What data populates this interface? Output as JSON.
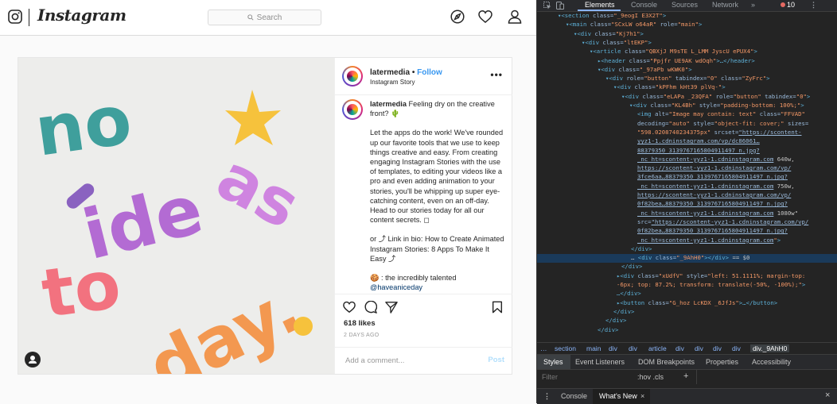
{
  "instagram": {
    "wordmark": "Instagram",
    "search_placeholder": "Search",
    "post": {
      "username": "latermedia",
      "follow_label": "Follow",
      "separator": "•",
      "subtitle": "Instagram Story",
      "more_label": "•••",
      "caption_user": "latermedia",
      "caption_p1": "Feeling dry on the creative front? 🌵",
      "caption_p2": "Let the apps do the work! We've rounded up our favorite tools that we use to keep things creative and easy. From creating engaging Instagram Stories with the use of templates, to editing your videos like a pro and even adding animation to your stories, you'll be whipping up super eye-catching content, even on an off-day. Head to our stories today for all our content secrets. ◻",
      "caption_p3": "or ⤴ Link in bio: How to Create Animated Instagram Stories: 8 Apps To Make It Easy ⤴",
      "caption_p4_prefix": "🍪 : the incredibly talented",
      "caption_mention": "@haveaniceday",
      "likes": "618 likes",
      "date": "2 DAYS AGO",
      "comment_placeholder": "Add a comment...",
      "post_button": "Post",
      "image_text": [
        "no",
        "ide",
        "as",
        "to",
        "day."
      ]
    },
    "colors": {
      "link": "#3897f0",
      "post_disabled": "#b2dffc"
    }
  },
  "devtools": {
    "tabs": [
      "Elements",
      "Console",
      "Sources",
      "Network",
      "»"
    ],
    "active_tab": "Elements",
    "error_count": "10",
    "dom_lines": [
      {
        "t": [
          [
            "tg",
            "▾<section "
          ],
          [
            "an",
            "class="
          ],
          [
            "av",
            "\"_9eogI E3X2T\""
          ],
          [
            "tg",
            ">"
          ]
        ]
      },
      {
        "t": [
          [
            "tg",
            "▾<main "
          ],
          [
            "an",
            "class="
          ],
          [
            "av",
            "\"SCxLW  o64aR\" "
          ],
          [
            "an",
            "role="
          ],
          [
            "av",
            "\"main\""
          ],
          [
            "tg",
            ">"
          ]
        ]
      },
      {
        "t": [
          [
            "tg",
            "▾<div "
          ],
          [
            "an",
            "class="
          ],
          [
            "av",
            "\"Kj7h1\""
          ],
          [
            "tg",
            ">"
          ]
        ]
      },
      {
        "t": [
          [
            "tg",
            "▾<div "
          ],
          [
            "an",
            "class="
          ],
          [
            "av",
            "\"ltEKP\""
          ],
          [
            "tg",
            ">"
          ]
        ]
      },
      {
        "t": [
          [
            "tg",
            "▾<article "
          ],
          [
            "an",
            "class="
          ],
          [
            "av",
            "\"QBXjJ M9sTE  L_LMM  JyscU  ePUX4\""
          ],
          [
            "tg",
            ">"
          ]
        ]
      },
      {
        "t": [
          [
            "tg",
            "▸<header "
          ],
          [
            "an",
            "class="
          ],
          [
            "av",
            "\"Ppjfr UE9AK  wdOqh\""
          ],
          [
            "tg",
            ">…</header>"
          ]
        ]
      },
      {
        "t": [
          [
            "tg",
            "▾<div "
          ],
          [
            "an",
            "class="
          ],
          [
            "av",
            "\"_97aPb wKWK0\""
          ],
          [
            "tg",
            ">"
          ]
        ]
      },
      {
        "t": [
          [
            "tg",
            "▾<div "
          ],
          [
            "an",
            "role="
          ],
          [
            "av",
            "\"button\" "
          ],
          [
            "an",
            "tabindex="
          ],
          [
            "av",
            "\"0\" "
          ],
          [
            "an",
            "class="
          ],
          [
            "av",
            "\"ZyFrc\""
          ],
          [
            "tg",
            ">"
          ]
        ]
      },
      {
        "t": [
          [
            "tg",
            "▾<div "
          ],
          [
            "an",
            "class="
          ],
          [
            "av",
            "\"kPFhm kHt39  plVq-\""
          ],
          [
            "tg",
            ">"
          ]
        ]
      },
      {
        "t": [
          [
            "tg",
            "▾<div "
          ],
          [
            "an",
            "class="
          ],
          [
            "av",
            "\"eLAPa _23QFA\" "
          ],
          [
            "an",
            "role="
          ],
          [
            "av",
            "\"button\" "
          ],
          [
            "an",
            "tabindex="
          ],
          [
            "av",
            "\"0\""
          ],
          [
            "tg",
            ">"
          ]
        ]
      },
      {
        "t": [
          [
            "tg",
            "▾<div "
          ],
          [
            "an",
            "class="
          ],
          [
            "av",
            "\"KL4Bh\" "
          ],
          [
            "an",
            "style="
          ],
          [
            "av",
            "\"padding-bottom: 100%;\""
          ],
          [
            "tg",
            ">"
          ]
        ]
      },
      {
        "t": [
          [
            "tg",
            "<img "
          ],
          [
            "an",
            "alt="
          ],
          [
            "av",
            "\"Image may contain: text\" "
          ],
          [
            "an",
            "class="
          ],
          [
            "av",
            "\"FFVAD\""
          ]
        ]
      },
      {
        "t": [
          [
            "an",
            "decoding="
          ],
          [
            "av",
            "\"auto\" "
          ],
          [
            "an",
            "style="
          ],
          [
            "av",
            "\"object-fit: cover;\" "
          ],
          [
            "an",
            "sizes="
          ]
        ]
      },
      {
        "t": [
          [
            "av",
            "\"598.0208740234375px\" "
          ],
          [
            "an",
            "srcset="
          ],
          [
            "ul",
            "\"https://scontent-"
          ]
        ]
      },
      {
        "t": [
          [
            "ul",
            "yyz1-1.cdninstagram.com/vp/dc86061…"
          ]
        ]
      },
      {
        "t": [
          [
            "ul",
            "88379350_3139767165804911497_n.jpg?"
          ]
        ]
      },
      {
        "t": [
          [
            "ul",
            "_nc_ht=scontent-yyz1-1.cdninstagram.com"
          ],
          [
            "tx",
            " 640w,"
          ]
        ]
      },
      {
        "t": [
          [
            "ul",
            "https://scontent-yyz1-1.cdninstagram.com/vp/"
          ]
        ]
      },
      {
        "t": [
          [
            "ul",
            "3fce6aa…88379350_3139767165804911497_n.jpg?"
          ]
        ]
      },
      {
        "t": [
          [
            "ul",
            "_nc_ht=scontent-yyz1-1.cdninstagram.com"
          ],
          [
            "tx",
            " 750w,"
          ]
        ]
      },
      {
        "t": [
          [
            "ul",
            "https://scontent-yyz1-1.cdninstagram.com/vp/"
          ]
        ]
      },
      {
        "t": [
          [
            "ul",
            "0f82bea…88379350_3139767165804911497_n.jpg?"
          ]
        ]
      },
      {
        "t": [
          [
            "ul",
            "_nc_ht=scontent-yyz1-1.cdninstagram.com"
          ],
          [
            "tx",
            " 1080w\""
          ]
        ]
      },
      {
        "t": [
          [
            "an",
            "src="
          ],
          [
            "ul",
            "\"https://scontent-yyz1-1.cdninstagram.com/vp/"
          ]
        ]
      },
      {
        "t": [
          [
            "ul",
            "0f82bea…88379350_3139767165804911497_n.jpg?"
          ]
        ]
      },
      {
        "t": [
          [
            "ul",
            "_nc_ht=scontent-yyz1-1.cdninstagram.com"
          ],
          [
            "av",
            "\""
          ],
          [
            "tg",
            ">"
          ]
        ]
      },
      {
        "t": [
          [
            "tg",
            "</div>"
          ]
        ]
      },
      {
        "t": [
          [
            "tx",
            "… "
          ],
          [
            "tg",
            "<div "
          ],
          [
            "an",
            "class="
          ],
          [
            "av",
            "\"_9AhH0\""
          ],
          [
            "tg",
            "></div>"
          ],
          [
            "tx",
            " == $0"
          ]
        ],
        "sel": true
      },
      {
        "t": [
          [
            "tg",
            "</div>"
          ]
        ]
      },
      {
        "t": [
          [
            "tg",
            "▸<div "
          ],
          [
            "an",
            "class="
          ],
          [
            "av",
            "\"xUdfV\" "
          ],
          [
            "an",
            "style="
          ],
          [
            "av",
            "\"left: 51.1111%; margin-top:"
          ]
        ]
      },
      {
        "t": [
          [
            "av",
            "-6px; top: 87.2%; transform: translate(-50%, -100%);\""
          ],
          [
            "tg",
            ">"
          ]
        ]
      },
      {
        "t": [
          [
            "tg",
            "…</div>"
          ]
        ]
      },
      {
        "t": [
          [
            "tg",
            "▸<button "
          ],
          [
            "an",
            "class="
          ],
          [
            "av",
            "\"G_hoz LcKDX _6JfJs\""
          ],
          [
            "tg",
            ">…</button>"
          ]
        ]
      },
      {
        "t": [
          [
            "tg",
            "</div>"
          ]
        ]
      },
      {
        "t": [
          [
            "tg",
            "</div>"
          ]
        ]
      },
      {
        "t": [
          [
            "tg",
            "</div>"
          ]
        ]
      }
    ],
    "breadcrumbs": [
      "…",
      "section",
      "main",
      "div",
      "div",
      "article",
      "div",
      "div",
      "div",
      "div",
      "div._9AhH0"
    ],
    "sub_tabs": [
      "Styles",
      "Event Listeners",
      "DOM Breakpoints",
      "Properties",
      "Accessibility"
    ],
    "filter_placeholder": "Filter",
    "filter_tools": ":hov  .cls",
    "filter_plus": "+",
    "drawer_tabs": [
      "Console",
      "What's New"
    ],
    "drawer_close": "×"
  }
}
